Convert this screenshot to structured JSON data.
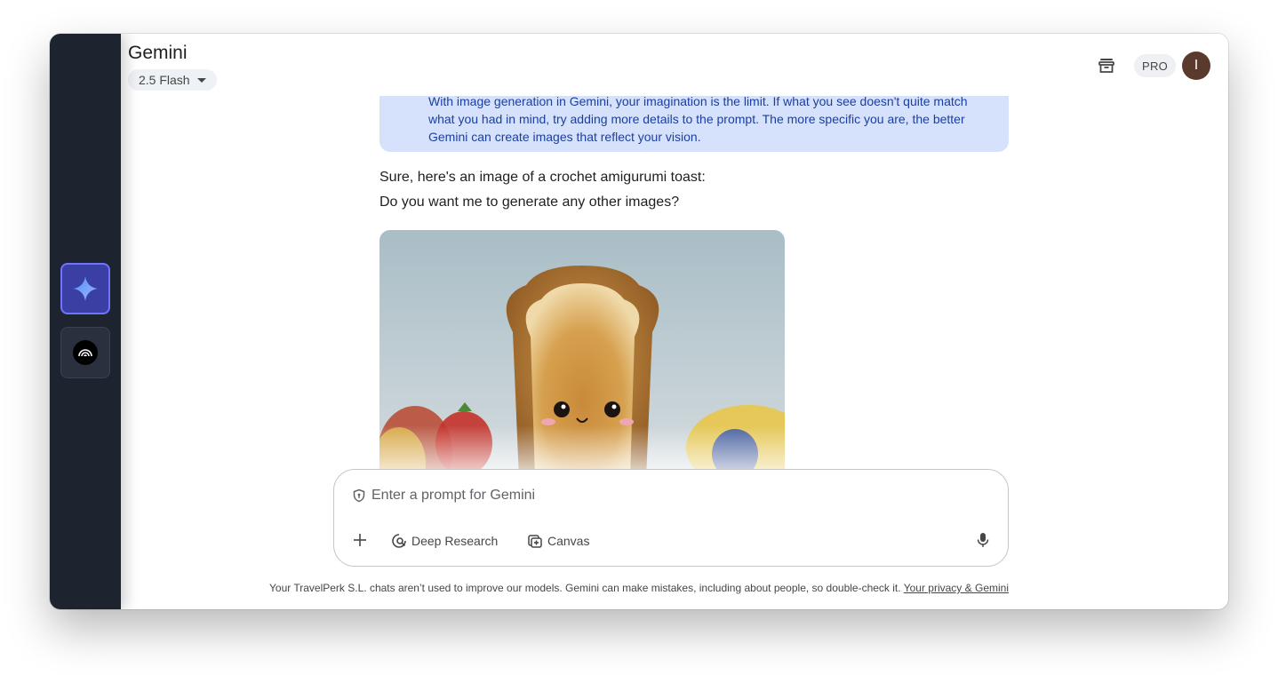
{
  "app": {
    "title": "Gemini",
    "model": "2.5 Flash",
    "pro_badge": "PRO",
    "avatar_initial": "I"
  },
  "rail": {
    "items": [
      {
        "name": "gemini",
        "icon": "gemini-sparkle-icon",
        "active": true
      },
      {
        "name": "gem",
        "icon": "gem-broadcast-icon",
        "active": false
      }
    ]
  },
  "header": {
    "icons": [
      "archive-icon"
    ]
  },
  "chat": {
    "info_text_lines": [
      "With image generation in Gemini, your imagination is the limit. If what you see doesn't quite match",
      "what you had in mind, try adding more details to the prompt. The more specific you are, the better",
      "Gemini can create images that reflect your vision."
    ],
    "response_line1": "Sure, here's an image of a crochet amigurumi toast:",
    "response_line2": "Do you want me to generate any other images?",
    "image_subject": "crochet amigurumi toast"
  },
  "composer": {
    "placeholder": "Enter a prompt for Gemini",
    "tools": {
      "deep_research": "Deep Research",
      "canvas": "Canvas"
    }
  },
  "footer": {
    "disclaimer": "Your TravelPerk S.L. chats aren’t used to improve our models. Gemini can make mistakes, including about people, so double-check it.",
    "privacy_link": "Your privacy & Gemini"
  },
  "colors": {
    "rail_bg": "#1e2330",
    "active_rail": "#3b3fa3",
    "info_card_bg": "#d6e2fb",
    "info_card_text": "#1b3fa0",
    "avatar_bg": "#5b3a2e"
  }
}
